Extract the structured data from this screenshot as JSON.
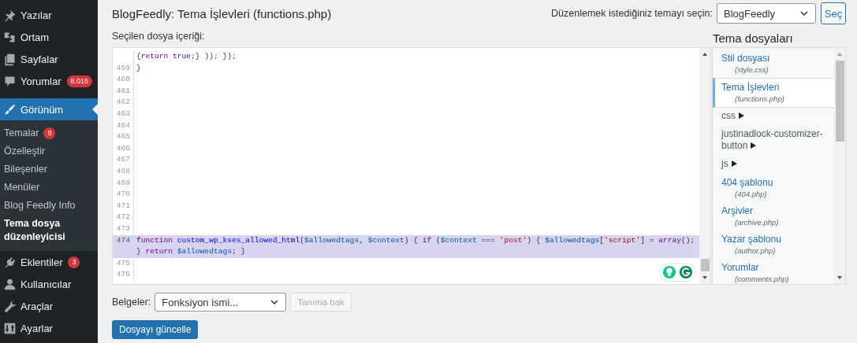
{
  "sidebar": {
    "groups": [
      {
        "items": [
          {
            "label": "Yazılar",
            "selected": false
          },
          {
            "label": "Ortam",
            "selected": false
          },
          {
            "label": "Sayfalar",
            "selected": false
          },
          {
            "label": "Yorumlar",
            "badge": "8.015",
            "selected": false
          }
        ]
      },
      {
        "items": [
          {
            "label": "Görünüm",
            "selected": true,
            "children": [
              {
                "label": "Temalar",
                "badge": "8",
                "selected": false
              },
              {
                "label": "Özelleştir",
                "selected": false
              },
              {
                "label": "Bileşenler",
                "selected": false
              },
              {
                "label": "Menüler",
                "selected": false
              },
              {
                "label": "Blog Feedly Info",
                "selected": false
              },
              {
                "label": "Tema dosya düzenleyicisi",
                "selected": true
              }
            ]
          },
          {
            "label": "Eklentiler",
            "badge": "3",
            "selected": false
          },
          {
            "label": "Kullanıcılar",
            "selected": false
          },
          {
            "label": "Araçlar",
            "selected": false
          },
          {
            "label": "Ayarlar",
            "selected": false
          }
        ]
      }
    ]
  },
  "page": {
    "title": "BlogFeedly: Tema İşlevleri (functions.php)",
    "theme_label": "Düzenlemek istediğiniz temayı seçin:",
    "theme_select": "BlogFeedly",
    "select_button": "Seç",
    "content_label": "Seçilen dosya içeriği:"
  },
  "editor": {
    "lines": [
      {
        "selected": false,
        "segments": [
          {
            "kind": "plain",
            "text": "{"
          },
          {
            "kind": "keyword",
            "text": "return"
          },
          {
            "kind": "atom",
            "text": " true"
          },
          {
            "kind": "plain",
            "text": ";} )); });"
          }
        ]
      },
      {
        "number": "459",
        "selected": false,
        "segments": [
          {
            "kind": "plain",
            "text": "}"
          }
        ]
      },
      {
        "number": "460",
        "selected": false
      },
      {
        "number": "461",
        "selected": false
      },
      {
        "number": "462",
        "selected": false
      },
      {
        "number": "463",
        "selected": false
      },
      {
        "number": "464",
        "selected": false
      },
      {
        "number": "465",
        "selected": false
      },
      {
        "number": "466",
        "selected": false
      },
      {
        "number": "467",
        "selected": false
      },
      {
        "number": "468",
        "selected": false
      },
      {
        "number": "469",
        "selected": false
      },
      {
        "number": "470",
        "selected": false
      },
      {
        "number": "471",
        "selected": false
      },
      {
        "number": "472",
        "selected": false
      },
      {
        "number": "473",
        "selected": false
      },
      {
        "number": "474",
        "selected": true,
        "segments": [
          {
            "kind": "keyword",
            "text": "function "
          },
          {
            "kind": "def",
            "text": "custom_wp_kses_allowed_html"
          },
          {
            "kind": "plain",
            "text": "("
          },
          {
            "kind": "variable",
            "text": "$allowedtags"
          },
          {
            "kind": "plain",
            "text": ", "
          },
          {
            "kind": "variable",
            "text": "$context"
          },
          {
            "kind": "plain",
            "text": ") { "
          },
          {
            "kind": "keyword",
            "text": "if"
          },
          {
            "kind": "plain",
            "text": " ("
          },
          {
            "kind": "variable",
            "text": "$context"
          },
          {
            "kind": "plain",
            "text": " === "
          },
          {
            "kind": "string",
            "text": "'post'"
          },
          {
            "kind": "plain",
            "text": ") { "
          },
          {
            "kind": "variable",
            "text": "$allowedtags"
          },
          {
            "kind": "plain",
            "text": "["
          },
          {
            "kind": "string",
            "text": "'script'"
          },
          {
            "kind": "plain",
            "text": "] = "
          },
          {
            "kind": "keyword",
            "text": "array"
          },
          {
            "kind": "plain",
            "text": "(); } "
          },
          {
            "kind": "keyword",
            "text": "return "
          },
          {
            "kind": "variable",
            "text": "$allowedtags"
          },
          {
            "kind": "plain",
            "text": "; }"
          }
        ]
      },
      {
        "number": "475",
        "selected": false
      },
      {
        "number": "476",
        "selected": false
      }
    ]
  },
  "files": {
    "heading": "Tema dosyaları",
    "items": [
      {
        "kind": "file",
        "name": "Stil dosyası",
        "filename": "(style.css)",
        "selected": false
      },
      {
        "kind": "file",
        "name": "Tema İşlevleri",
        "filename": "(functions.php)",
        "selected": true
      },
      {
        "kind": "folder",
        "name": "css",
        "selected": false
      },
      {
        "kind": "folder",
        "name": "justinadlock-customizer-button",
        "selected": false
      },
      {
        "kind": "folder",
        "name": "js",
        "selected": false
      },
      {
        "kind": "file",
        "name": "404 şablonu",
        "filename": "(404.php)",
        "selected": false
      },
      {
        "kind": "file",
        "name": "Arşivler",
        "filename": "(archive.php)",
        "selected": false
      },
      {
        "kind": "file",
        "name": "Yazar şablonu",
        "filename": "(author.php)",
        "selected": false
      },
      {
        "kind": "file",
        "name": "Yorumlar",
        "filename": "(comments.php)",
        "selected": false
      }
    ]
  },
  "docs": {
    "label": "Belgeler:",
    "select": "Fonksiyon ismi...",
    "lookup_button": "Tanıma bak",
    "lookup_disabled": true
  },
  "update_button": "Dosyayı güncelle"
}
